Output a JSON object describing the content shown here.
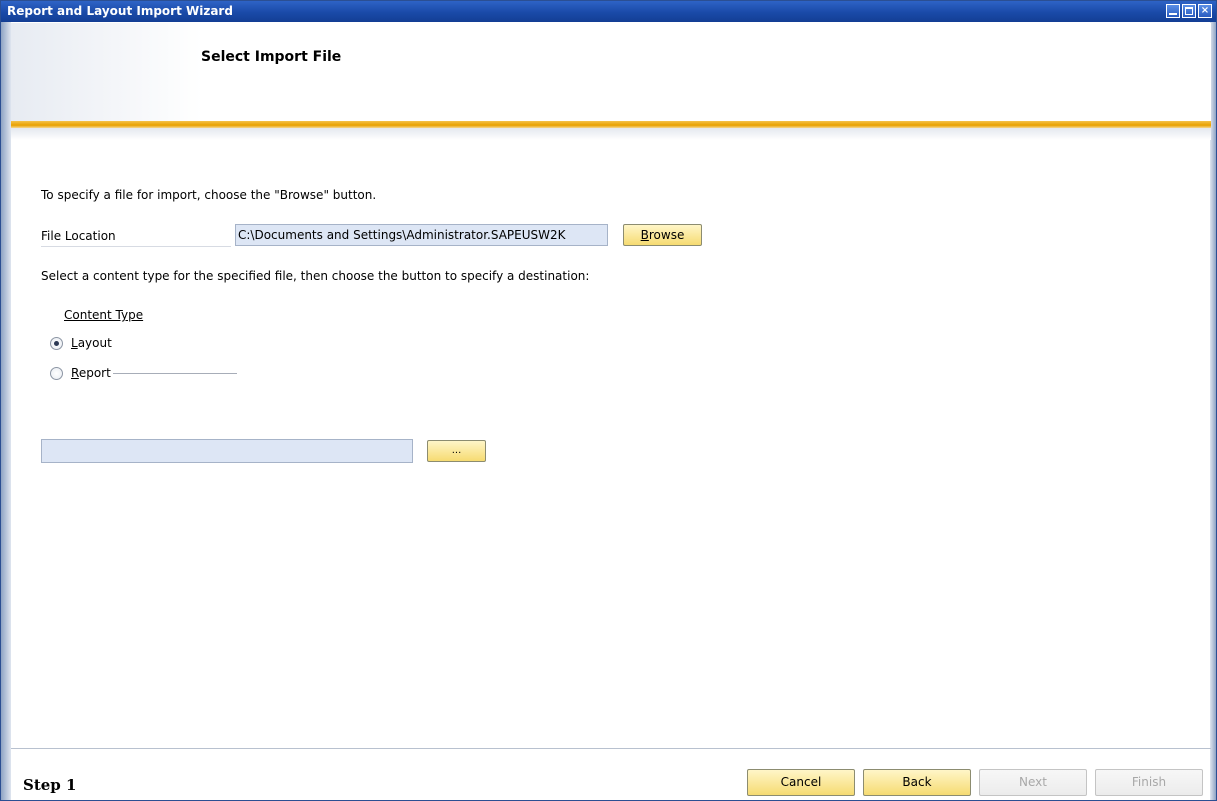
{
  "window": {
    "title": "Report and Layout Import Wizard",
    "controls": [
      "minimize",
      "maximize",
      "close"
    ]
  },
  "header": {
    "page_title": "Select Import File"
  },
  "main": {
    "instruction": "To specify a file for import, choose the \"Browse\" button.",
    "file_location_label": "File Location",
    "file_location_value": "C:\\Documents and Settings\\Administrator.SAPEUSW2K",
    "browse_label_first": "B",
    "browse_label_rest": "rowse",
    "select_instruction": "Select a content type for the specified file, then choose the button to specify a destination:",
    "content_type": {
      "title": "Content Type",
      "options": [
        {
          "mnemonic": "L",
          "rest": "ayout",
          "selected": true
        },
        {
          "mnemonic": "R",
          "rest": "eport",
          "selected": false
        }
      ]
    },
    "destination_value": "",
    "destination_button": "..."
  },
  "footer": {
    "step": "Step 1",
    "buttons": {
      "cancel": "Cancel",
      "back": "Back",
      "next": "Next",
      "finish": "Finish"
    },
    "disabled": [
      "next",
      "finish"
    ]
  },
  "colors": {
    "titlebar": "#1a4aa8",
    "accent_gold": "#e8a000",
    "button": "#f6db72",
    "input_bg": "#dde6f5"
  }
}
